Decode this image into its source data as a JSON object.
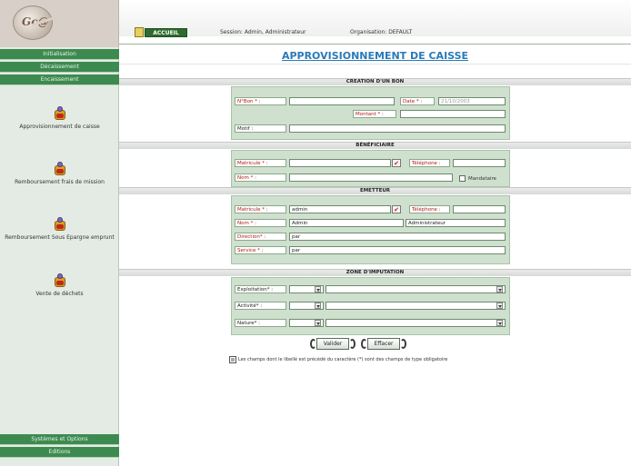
{
  "header": {
    "home_label": "ACCUEIL",
    "session": "Session: Admin, Administrateur",
    "organisation": "Organisation: DEFAULT"
  },
  "sidebar": {
    "sections": [
      {
        "label": "Initialisation"
      },
      {
        "label": "Décaissement"
      },
      {
        "label": "Encaissement"
      }
    ],
    "items": [
      {
        "label": "Approvisionnement de caisse"
      },
      {
        "label": "Remboursement frais de mission"
      },
      {
        "label": "Remboursement Sous Epargne emprunt"
      },
      {
        "label": "Vente de déchets"
      }
    ],
    "footer": [
      {
        "label": "Systèmes et Options"
      },
      {
        "label": "Editions"
      }
    ]
  },
  "page": {
    "title": "APPROVISIONNEMENT DE CAISSE"
  },
  "creation": {
    "header": "CREATION D'UN BON",
    "num_label": "N°Bon * :",
    "num_value": "",
    "date_label": "Date * :",
    "date_value": "21/10/2003",
    "montant_label": "Montant * :",
    "montant_value": "",
    "motif_label": "Motif :",
    "motif_value": ""
  },
  "beneficiaire": {
    "header": "BÉNÉFICIAIRE",
    "matricule_label": "Matricule * :",
    "matricule_value": "",
    "telephone_label": "Téléphone :",
    "telephone_value": "",
    "nom_label": "Nom * :",
    "nom_value": "",
    "mandataire_label": "Mandataire"
  },
  "emetteur": {
    "header": "EMETTEUR",
    "matricule_label": "Matricule * :",
    "matricule_value": "admin",
    "telephone_label": "Téléphone :",
    "telephone_value": "",
    "nom_label": "Nom * :",
    "nom_value": "Admin",
    "prenom_value": "Administrateur",
    "direction_label": "Direction* :",
    "direction_value": "par",
    "service_label": "Service * :",
    "service_value": "par"
  },
  "imputation": {
    "header": "ZONE D'IMPUTATION",
    "exploitation_label": "Exploitation* :",
    "activite_label": "Activité* :",
    "nature_label": "Nature* :"
  },
  "actions": {
    "validate_label": "Valider",
    "clear_label": "Effacer"
  },
  "footer_note": "Les champs dont le libellé est précédé du caractère (*) sont des champs de type obligatoire"
}
